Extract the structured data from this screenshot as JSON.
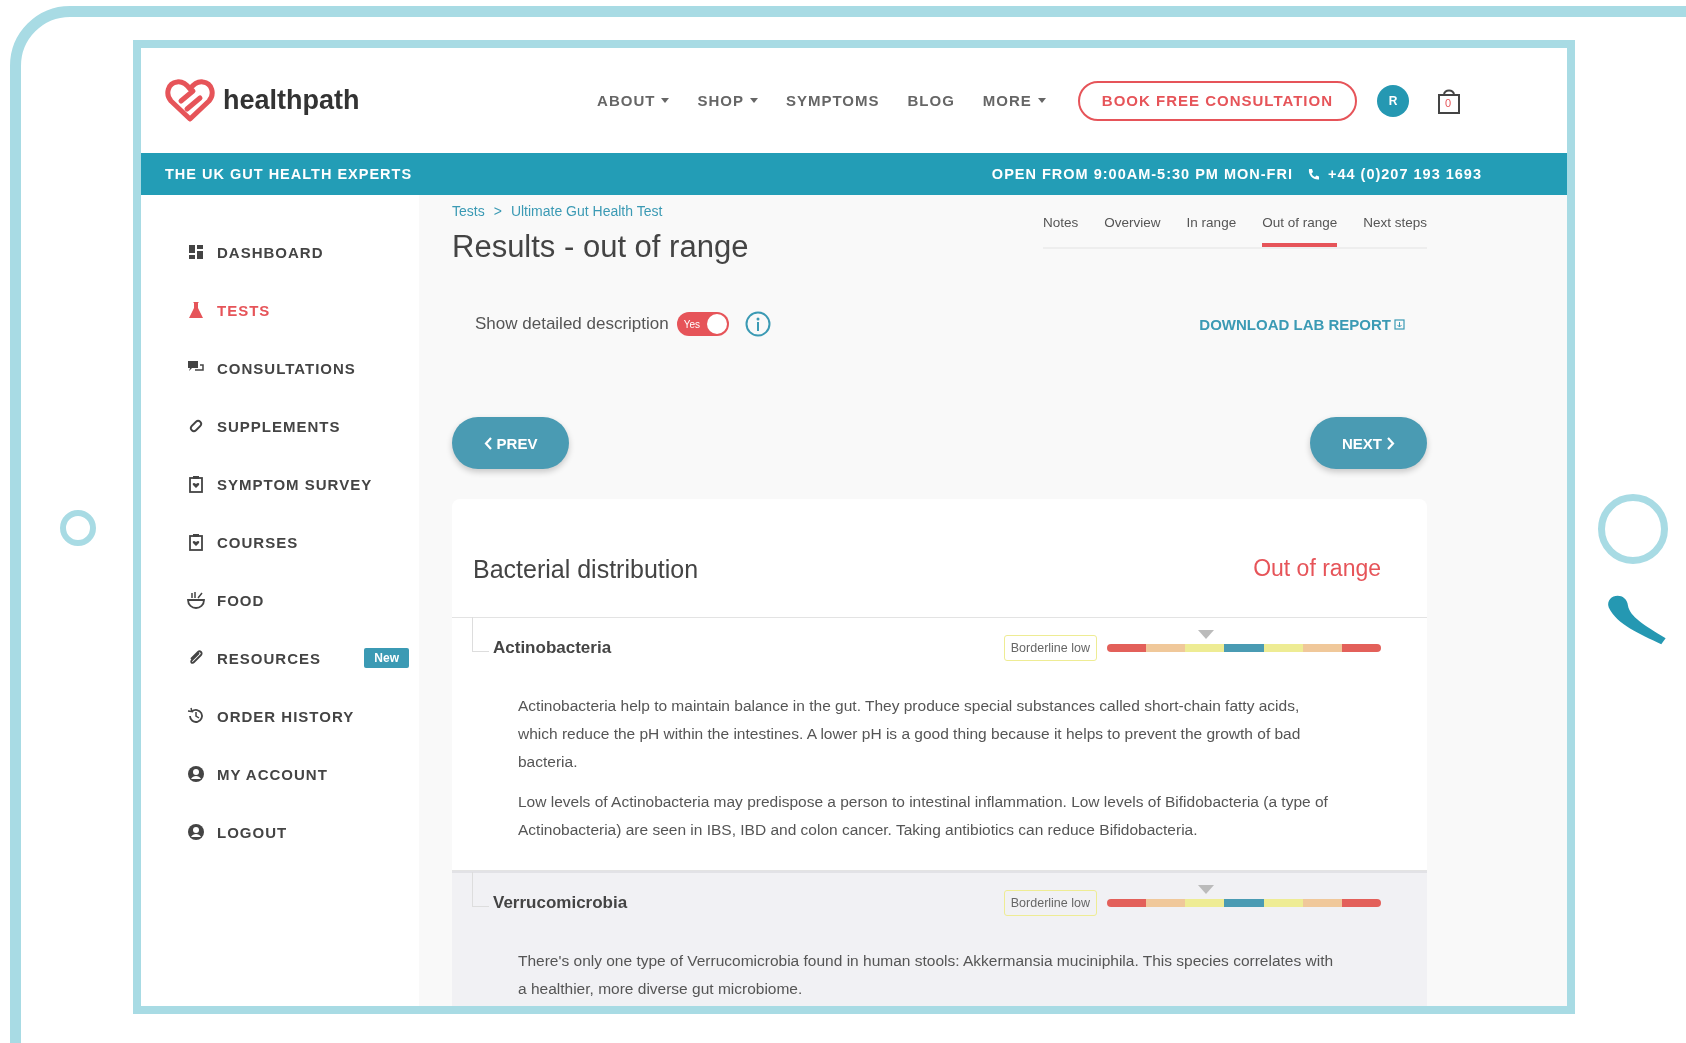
{
  "header": {
    "logo": "healthpath",
    "nav": [
      {
        "label": "ABOUT",
        "dropdown": true
      },
      {
        "label": "SHOP",
        "dropdown": true
      },
      {
        "label": "SYMPTOMS",
        "dropdown": false
      },
      {
        "label": "BLOG",
        "dropdown": false
      },
      {
        "label": "MORE",
        "dropdown": true
      }
    ],
    "cta": "BOOK FREE CONSULTATION",
    "avatar": "R",
    "cart_count": "0"
  },
  "banner": {
    "tagline": "THE UK GUT HEALTH EXPERTS",
    "hours": "OPEN FROM 9:00AM-5:30 PM MON-FRI",
    "phone": "+44 (0)207 193 1693"
  },
  "sidebar": {
    "items": [
      {
        "label": "DASHBOARD",
        "selected": false
      },
      {
        "label": "TESTS",
        "selected": true
      },
      {
        "label": "CONSULTATIONS",
        "selected": false
      },
      {
        "label": "SUPPLEMENTS",
        "selected": false
      },
      {
        "label": "SYMPTOM SURVEY",
        "selected": false
      },
      {
        "label": "COURSES",
        "selected": false
      },
      {
        "label": "FOOD",
        "selected": false
      },
      {
        "label": "RESOURCES",
        "selected": false,
        "badge": "New"
      },
      {
        "label": "ORDER HISTORY",
        "selected": false
      },
      {
        "label": "MY ACCOUNT",
        "selected": false
      },
      {
        "label": "LOGOUT",
        "selected": false
      }
    ]
  },
  "breadcrumb": [
    "Tests",
    "Ultimate Gut Health Test"
  ],
  "breadcrumb_separator": ">",
  "title": "Results - out of range",
  "tabs": [
    {
      "label": "Notes",
      "selected": false
    },
    {
      "label": "Overview",
      "selected": false
    },
    {
      "label": "In range",
      "selected": false
    },
    {
      "label": "Out of range",
      "selected": true
    },
    {
      "label": "Next steps",
      "selected": false
    }
  ],
  "toggle": {
    "label": "Show detailed description",
    "text": "Yes",
    "on": true
  },
  "download": "DOWNLOAD LAB REPORT",
  "prev": "PREV",
  "next": "NEXT",
  "card": {
    "title": "Bacterial distribution",
    "status": "Out of range",
    "rows": [
      {
        "name": "Actinobacteria",
        "highlighted": false,
        "meter": {
          "label": "Borderline low",
          "level": 0.36
        },
        "paragraphs": [
          "Actinobacteria help to maintain balance in the gut. They produce special substances called short-chain fatty acids, which reduce the pH within the intestines. A lower pH is a good thing because it helps to prevent the growth of bad bacteria.",
          "Low levels of Actinobacteria may predispose a person to intestinal inflammation. Low levels of Bifidobacteria (a type of Actinobacteria) are seen in IBS, IBD and colon cancer. Taking antibiotics can reduce Bifidobacteria."
        ]
      },
      {
        "name": "Verrucomicrobia",
        "highlighted": true,
        "meter": {
          "label": "Borderline low",
          "level": 0.36
        },
        "paragraphs": [
          "There's only one type of Verrucomicrobia found in human stools: Akkermansia muciniphila. This species correlates with a healthier, more diverse gut microbiome."
        ]
      }
    ]
  }
}
